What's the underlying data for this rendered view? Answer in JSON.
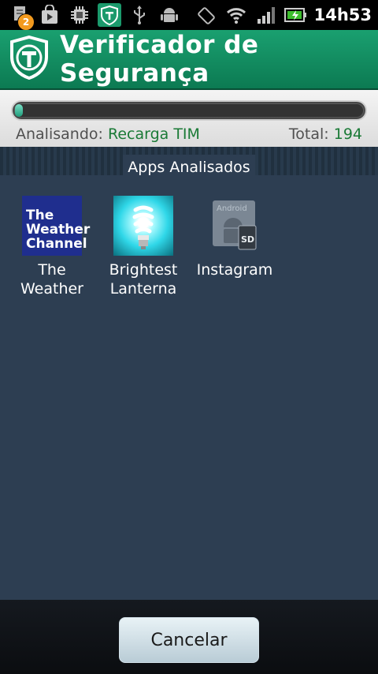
{
  "status_bar": {
    "notification_count": "2",
    "time": "14h53",
    "icons": [
      "notification-icon",
      "shop-bag-icon",
      "chip-icon",
      "shield-app-icon",
      "usb-icon",
      "android-debug-icon",
      "rotate-icon",
      "wifi-icon",
      "signal-icon",
      "battery-icon"
    ]
  },
  "header": {
    "title": "Verificador de Segurança",
    "logo": "shield-t-icon"
  },
  "scan": {
    "progress": 0.02,
    "analyzing_label": "Analisando:",
    "analyzing_value": "Recarga TIM",
    "total_label": "Total:",
    "total_value": "194"
  },
  "apps_section": {
    "title": "Apps Analisados",
    "apps": [
      {
        "name": "The Weather",
        "icon": "weather-channel-icon",
        "icon_text": [
          "The",
          "Weather",
          "Channel"
        ]
      },
      {
        "name": "Brightest Lanterna",
        "icon": "lightbulb-icon"
      },
      {
        "name": "Instagram",
        "icon": "android-sd-icon",
        "icon_text": [
          "Android",
          "SD"
        ]
      }
    ]
  },
  "footer": {
    "cancel_label": "Cancelar"
  },
  "colors": {
    "header_green": "#11885c",
    "accent_text_green": "#1a7a36",
    "main_bg": "#2d3e52"
  }
}
